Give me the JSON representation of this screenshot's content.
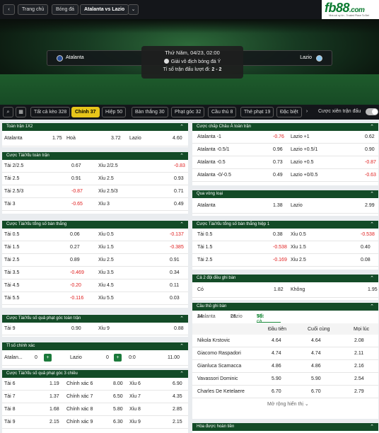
{
  "breadcrumb": {
    "home": "Trang chủ",
    "football": "Bóng đá",
    "match": "Atalanta vs Lazio"
  },
  "logo": {
    "text": "fb88",
    "suffix": ".com",
    "tagline": "Nhà cái uy tín - Trusted Place To Bet"
  },
  "match": {
    "date": "Thứ Năm, 04/23, 02:00",
    "league": "Giải vô địch bóng đá Ý",
    "score_label": "Tỉ số trận đấu lượt đi:",
    "score": "2 - 2",
    "home": "Atalanta",
    "away": "Lazio"
  },
  "tabs": [
    "Tất cả kèo 328",
    "Chính 37",
    "Hiệp 50",
    "Bàn thắng 30",
    "Phạt góc 32",
    "Cầu thủ 8",
    "Thẻ phạt 19",
    "Đặc biệt"
  ],
  "parlay_label": "Cược xiên trận đấu",
  "left": {
    "p1": {
      "title": "Toàn trận 1X2",
      "cells": [
        "Atalanta",
        "1.75",
        "Hoà",
        "3.72",
        "Lazio",
        "4.60"
      ]
    },
    "p2": {
      "title": "Cược Tài/Xỉu toàn trận",
      "rows": [
        [
          "Tài 2/2.5",
          "0.67",
          "Xỉu 2/2.5",
          "-0.83"
        ],
        [
          "Tài 2.5",
          "0.91",
          "Xỉu 2.5",
          "0.93"
        ],
        [
          "Tài 2.5/3",
          "-0.87",
          "Xỉu 2.5/3",
          "0.71"
        ],
        [
          "Tài 3",
          "-0.65",
          "Xỉu 3",
          "0.49"
        ]
      ]
    },
    "p3": {
      "title": "Cược Tài/Xỉu tổng số bàn thắng",
      "rows": [
        [
          "Tài 0.5",
          "0.06",
          "Xỉu 0.5",
          "-0.137"
        ],
        [
          "Tài 1.5",
          "0.27",
          "Xỉu 1.5",
          "-0.385"
        ],
        [
          "Tài 2.5",
          "0.89",
          "Xỉu 2.5",
          "0.91"
        ],
        [
          "Tài 3.5",
          "-0.469",
          "Xỉu 3.5",
          "0.34"
        ],
        [
          "Tài 4.5",
          "-0.20",
          "Xỉu 4.5",
          "0.11"
        ],
        [
          "Tài 5.5",
          "-0.116",
          "Xỉu 5.5",
          "0.03"
        ]
      ]
    },
    "p4": {
      "title": "Cược Tài/Xỉu số quả phạt góc toàn trận",
      "rows": [
        [
          "Tài 9",
          "0.90",
          "Xỉu 9",
          "0.88"
        ]
      ]
    },
    "p5": {
      "title": "Tỉ số chính xác",
      "home": "Atalan...",
      "hs": "0",
      "away": "Lazio",
      "as": "0",
      "score": "0:0",
      "odds": "11.00"
    },
    "p6": {
      "title": "Cược Tài/Xỉu số quả phạt góc 3 chiều",
      "rows": [
        [
          "Tài 6",
          "1.19",
          "Chính xác 6",
          "8.00",
          "Xỉu 6",
          "6.90"
        ],
        [
          "Tài 7",
          "1.37",
          "Chính xác 7",
          "6.50",
          "Xỉu 7",
          "4.35"
        ],
        [
          "Tài 8",
          "1.68",
          "Chính xác 8",
          "5.80",
          "Xỉu 8",
          "2.85"
        ],
        [
          "Tài 9",
          "2.15",
          "Chính xác 9",
          "6.30",
          "Xỉu 9",
          "2.15"
        ]
      ]
    }
  },
  "right": {
    "r1": {
      "title": "Cược chấp Châu Á toàn trận",
      "rows": [
        [
          "Atalanta -1",
          "-0.76",
          "Lazio +1",
          "0.62"
        ],
        [
          "Atalanta -0.5/1",
          "0.96",
          "Lazio +0.5/1",
          "0.90"
        ],
        [
          "Atalanta -0.5",
          "0.73",
          "Lazio +0.5",
          "-0.87"
        ],
        [
          "Atalanta -0/-0.5",
          "0.49",
          "Lazio +0/0.5",
          "-0.63"
        ]
      ]
    },
    "r2": {
      "title": "Qua vòng loại",
      "cells": [
        "Atalanta",
        "1.38",
        "Lazio",
        "2.99"
      ]
    },
    "r3": {
      "title": "Cược Tài/Xỉu tổng số bàn thắng hiệp 1",
      "rows": [
        [
          "Tài 0.5",
          "0.38",
          "Xỉu 0.5",
          "-0.538"
        ],
        [
          "Tài 1.5",
          "-0.538",
          "Xỉu 1.5",
          "0.40"
        ],
        [
          "Tài 2.5",
          "-0.169",
          "Xỉu 2.5",
          "0.08"
        ]
      ]
    },
    "r4": {
      "title": "Cả 2 đội đều ghi bàn",
      "cells": [
        "Có",
        "1.82",
        "Không",
        "1.95"
      ]
    },
    "r5": {
      "title": "Cầu thủ ghi bàn",
      "subtabs": [
        "Atalanta",
        "24",
        "Lazio",
        "26",
        "Tất cả",
        "50"
      ],
      "headers": [
        "Đầu tiên",
        "Cuối cùng",
        "Mọi lúc"
      ],
      "rows": [
        [
          "Nikola Krstovic",
          "4.64",
          "4.64",
          "2.08"
        ],
        [
          "Giacomo Raspadori",
          "4.74",
          "4.74",
          "2.11"
        ],
        [
          "Gianluca Scamacca",
          "4.86",
          "4.86",
          "2.16"
        ],
        [
          "Vavassori Dominic",
          "5.90",
          "5.90",
          "2.54"
        ],
        [
          "Charles De Ketelaere",
          "6.70",
          "6.70",
          "2.79"
        ]
      ],
      "expand": "Mở rộng hiển thị"
    },
    "r6": {
      "title": "Hòa được hoàn tiền"
    }
  }
}
